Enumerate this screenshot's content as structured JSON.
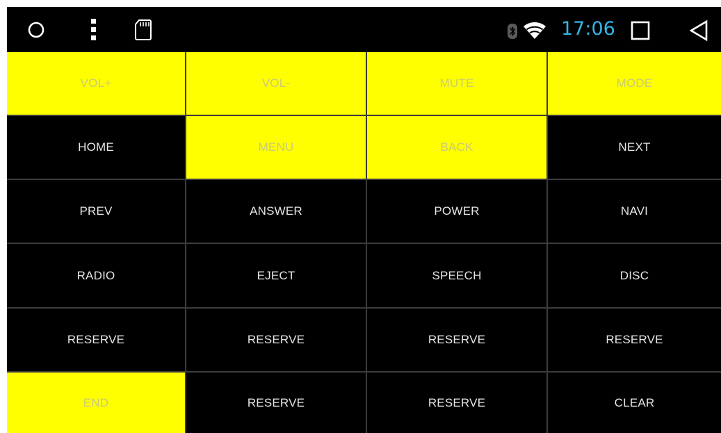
{
  "status_bar": {
    "time": "17:06",
    "time_color": "#33b5e5",
    "icons": {
      "left": [
        "circle-icon",
        "overflow-menu-icon",
        "sd-card-icon"
      ],
      "right": [
        "bluetooth-icon",
        "wifi-icon"
      ],
      "nav": [
        "recents-square-icon",
        "back-triangle-icon"
      ]
    }
  },
  "colors": {
    "active_key": "#ffff00",
    "inactive_key": "#000000",
    "grid_line": "#3c3c3c",
    "label": "#e6e6e6",
    "label_on_active": "#c9c97a"
  },
  "keys": [
    {
      "label": "VOL+",
      "active": true
    },
    {
      "label": "VOL-",
      "active": true
    },
    {
      "label": "MUTE",
      "active": true
    },
    {
      "label": "MODE",
      "active": true
    },
    {
      "label": "HOME",
      "active": false
    },
    {
      "label": "MENU",
      "active": true
    },
    {
      "label": "BACK",
      "active": true
    },
    {
      "label": "NEXT",
      "active": false
    },
    {
      "label": "PREV",
      "active": false
    },
    {
      "label": "ANSWER",
      "active": false
    },
    {
      "label": "POWER",
      "active": false
    },
    {
      "label": "NAVI",
      "active": false
    },
    {
      "label": "RADIO",
      "active": false
    },
    {
      "label": "EJECT",
      "active": false
    },
    {
      "label": "SPEECH",
      "active": false
    },
    {
      "label": "DISC",
      "active": false
    },
    {
      "label": "RESERVE",
      "active": false
    },
    {
      "label": "RESERVE",
      "active": false
    },
    {
      "label": "RESERVE",
      "active": false
    },
    {
      "label": "RESERVE",
      "active": false
    },
    {
      "label": "END",
      "active": true
    },
    {
      "label": "RESERVE",
      "active": false
    },
    {
      "label": "RESERVE",
      "active": false
    },
    {
      "label": "CLEAR",
      "active": false
    }
  ]
}
